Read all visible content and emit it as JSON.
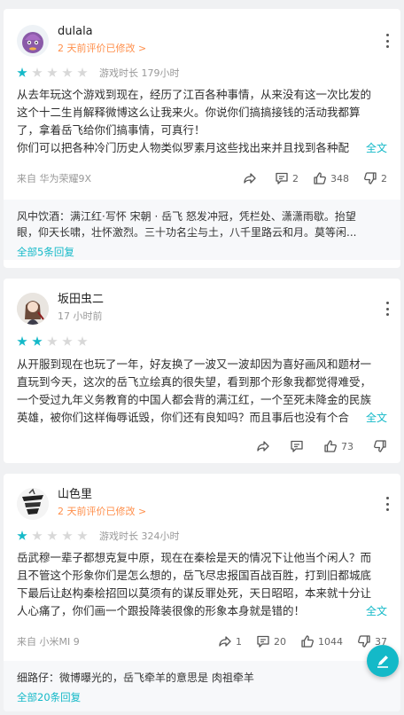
{
  "reviews": [
    {
      "username": "dulala",
      "time": "2 天前评价已修改",
      "time_arrow": ">",
      "rating": 1,
      "playtime": "游戏时长 179小时",
      "lines": [
        "从去年玩这个游戏到现在，经历了江百各种事情，从来没有这一次比发的",
        "这个十二生肖解释微博这么让我来火。你说你们搞搞接钱的活动我都算",
        "了，拿着岳飞给你们搞事情，可真行！"
      ],
      "last_line": "你们可以把各种冷门历史人物类似罗素月这些找出来并且找到各种配",
      "expand": "全文",
      "device": "来自 华为荣耀9X",
      "share_count": "",
      "comment_count": "2",
      "like_count": "348",
      "dislike_count": "2",
      "replies": [
        "风中饮酒：满江红·写怀 宋朝 · 岳飞 怒发冲冠，凭栏处、潇潇雨歇。抬望",
        "眼，仰天长啸，壮怀激烈。三十功名尘与土，八千里路云和月。莫等闲..."
      ],
      "all_replies": "全部5条回复"
    },
    {
      "username": "坂田虫二",
      "time": "17 小时前",
      "rating": 2,
      "lines": [
        "从开服到现在也玩了一年，好友换了一波又一波却因为喜好画风和题材一",
        "直玩到今天，这次的岳飞立绘真的很失望，看到那个形象我都觉得难受，",
        "一个受过九年义务教育的中国人都会背的满江红，一个至死未降金的民族"
      ],
      "last_line": "英雄，被你们这样侮辱诋毁，你们还有良知吗？而且事后也没有个合",
      "expand": "全文",
      "like_count": "73"
    },
    {
      "username": "山色里",
      "time": "2 天前评价已修改",
      "time_arrow": ">",
      "rating": 1,
      "playtime": "游戏时长 324小时",
      "lines": [
        "岳武穆一辈子都想克复中原，现在在秦桧是天的情况下让他当个闲人？而",
        "且不管这个形象你们是怎么想的，岳飞尽忠报国百战百胜，打到旧都城底",
        "下最后让赵构秦桧招回以莫须有的谋反罪处死，天日昭昭，本来就十分让"
      ],
      "last_line": "人心痛了，你们画一个跟投降装很像的形象本身就是错的！",
      "expand": "全文",
      "device": "来自 小米MI 9",
      "share_count": "1",
      "comment_count": "20",
      "like_count": "1044",
      "dislike_count": "37",
      "replies": [
        "细路仔：微博曝光的，岳飞牵羊的意思是 肉祖牵羊"
      ],
      "all_replies": "全部20条回复"
    }
  ],
  "colors": {
    "accent": "#14b9c8",
    "orange": "#ff8f4b",
    "background": "#f0f1f3"
  },
  "icons": [
    "more-icon",
    "share-icon",
    "comment-icon",
    "like-icon",
    "dislike-icon",
    "pencil-icon"
  ]
}
